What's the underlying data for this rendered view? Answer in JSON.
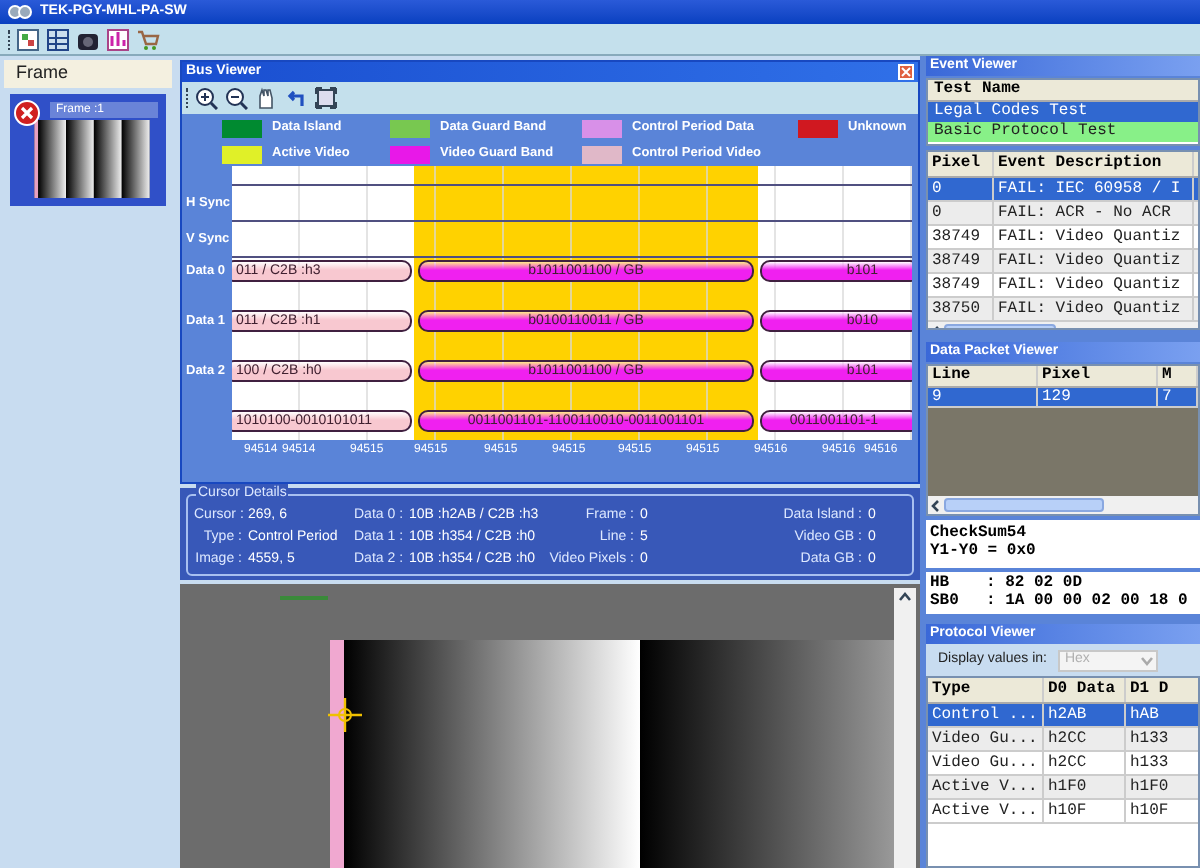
{
  "window": {
    "title": "TEK-PGY-MHL-PA-SW"
  },
  "frame_panel": {
    "title": "Frame",
    "frames": [
      {
        "label": "Frame :1",
        "selected": true,
        "error": true
      }
    ]
  },
  "bus_viewer": {
    "title": "Bus Viewer",
    "legend": [
      {
        "label": "Data Island",
        "color": "#008a30"
      },
      {
        "label": "Data Guard Band",
        "color": "#78c850"
      },
      {
        "label": "Control Period Data",
        "color": "#d890e8"
      },
      {
        "label": "Unknown",
        "color": "#d01820"
      },
      {
        "label": "Active Video",
        "color": "#e0f028"
      },
      {
        "label": "Video Guard Band",
        "color": "#e818e8"
      },
      {
        "label": "Control Period Video",
        "color": "#e0b8c8"
      }
    ],
    "rows": [
      {
        "label": "H Sync"
      },
      {
        "label": "V Sync"
      },
      {
        "label": "Data 0",
        "segments": [
          {
            "text": "011 / C2B :h3",
            "color": "#f8c8d0"
          },
          {
            "text": "b1011001100 / GB",
            "color": "#f020f0"
          },
          {
            "text": "b101",
            "color": "#f020f0"
          }
        ]
      },
      {
        "label": "Data 1",
        "segments": [
          {
            "text": "011 / C2B :h1",
            "color": "#f8c8d0"
          },
          {
            "text": "b0100110011 / GB",
            "color": "#f020f0"
          },
          {
            "text": "b010",
            "color": "#f020f0"
          }
        ]
      },
      {
        "label": "Data 2",
        "segments": [
          {
            "text": "100 / C2B :h0",
            "color": "#f8c8d0"
          },
          {
            "text": "b1011001100 / GB",
            "color": "#f020f0"
          },
          {
            "text": "b101",
            "color": "#f020f0"
          }
        ]
      },
      {
        "segments": [
          {
            "text": "1010100-0010101011",
            "color": "#f8c8d0"
          },
          {
            "text": "0011001101-1100110010-0011001101",
            "color": "#f020f0"
          },
          {
            "text": "0011001101-1",
            "color": "#f020f0"
          }
        ]
      }
    ],
    "ticks": [
      "94514",
      "94514",
      "94515",
      "94515",
      "94515",
      "94515",
      "94515",
      "94515",
      "94516",
      "94516",
      "94516"
    ]
  },
  "cursor_details": {
    "title": "Cursor Details",
    "columns": [
      [
        {
          "label": "Cursor :",
          "value": "269, 6"
        },
        {
          "label": "Type :",
          "value": "Control Period"
        },
        {
          "label": "Image :",
          "value": "4559, 5"
        }
      ],
      [
        {
          "label": "Data 0 :",
          "value": "10B :h2AB / C2B :h3"
        },
        {
          "label": "Data 1 :",
          "value": "10B :h354 / C2B :h0"
        },
        {
          "label": "Data 2 :",
          "value": "10B :h354 / C2B :h0"
        }
      ],
      [
        {
          "label": "Frame :",
          "value": "0"
        },
        {
          "label": "Line :",
          "value": "5"
        },
        {
          "label": "Video Pixels :",
          "value": "0"
        }
      ],
      [
        {
          "label": "Data Island :",
          "value": "0"
        },
        {
          "label": "Video GB :",
          "value": "0"
        },
        {
          "label": "Data GB :",
          "value": "0"
        }
      ]
    ]
  },
  "event_viewer": {
    "title": "Event Viewer",
    "tests": {
      "column": "Test Name",
      "rows": [
        {
          "name": "Legal Codes Test",
          "selected": true,
          "passed": false
        },
        {
          "name": "Basic Protocol Test",
          "selected": false,
          "passed": true
        }
      ]
    },
    "events": {
      "columns": [
        "Pixel",
        "Event Description"
      ],
      "rows": [
        {
          "pixel": "0",
          "description": "FAIL: IEC 60958 / I",
          "selected": true
        },
        {
          "pixel": "0",
          "description": "FAIL: ACR - No ACR",
          "selected": false
        },
        {
          "pixel": "38749",
          "description": "FAIL: Video Quantiz",
          "selected": false
        },
        {
          "pixel": "38749",
          "description": "FAIL: Video Quantiz",
          "selected": false
        },
        {
          "pixel": "38749",
          "description": "FAIL: Video Quantiz",
          "selected": false
        },
        {
          "pixel": "38750",
          "description": "FAIL: Video Quantiz",
          "selected": false
        }
      ]
    }
  },
  "data_packet_viewer": {
    "title": "Data Packet Viewer",
    "columns": [
      "Line",
      "Pixel",
      "M"
    ],
    "rows": [
      {
        "cells": [
          "9",
          "129",
          "7"
        ],
        "selected": true
      }
    ],
    "summary": [
      "CheckSum54",
      "Y1-Y0 = 0x0"
    ],
    "bytes": [
      {
        "label": "HB",
        "value": ": 82 02 0D"
      },
      {
        "label": "SB0",
        "value": ": 1A 00 00 02 00 18 0"
      }
    ]
  },
  "protocol_viewer": {
    "title": "Protocol Viewer",
    "display_label": "Display values in:",
    "display_value": {
      "value": "Hex",
      "disabled": true
    },
    "columns": [
      "Type",
      "D0 Data",
      "D1 D"
    ],
    "rows": [
      {
        "cells": [
          "Control ...",
          "h2AB",
          "hAB"
        ],
        "selected": true
      },
      {
        "cells": [
          "Video Gu...",
          "h2CC",
          "h133"
        ],
        "selected": false
      },
      {
        "cells": [
          "Video Gu...",
          "h2CC",
          "h133"
        ],
        "selected": false
      },
      {
        "cells": [
          "Active V...",
          "h1F0",
          "h1F0"
        ],
        "selected": false
      },
      {
        "cells": [
          "Active V...",
          "h10F",
          "h10F"
        ],
        "selected": false
      }
    ]
  }
}
